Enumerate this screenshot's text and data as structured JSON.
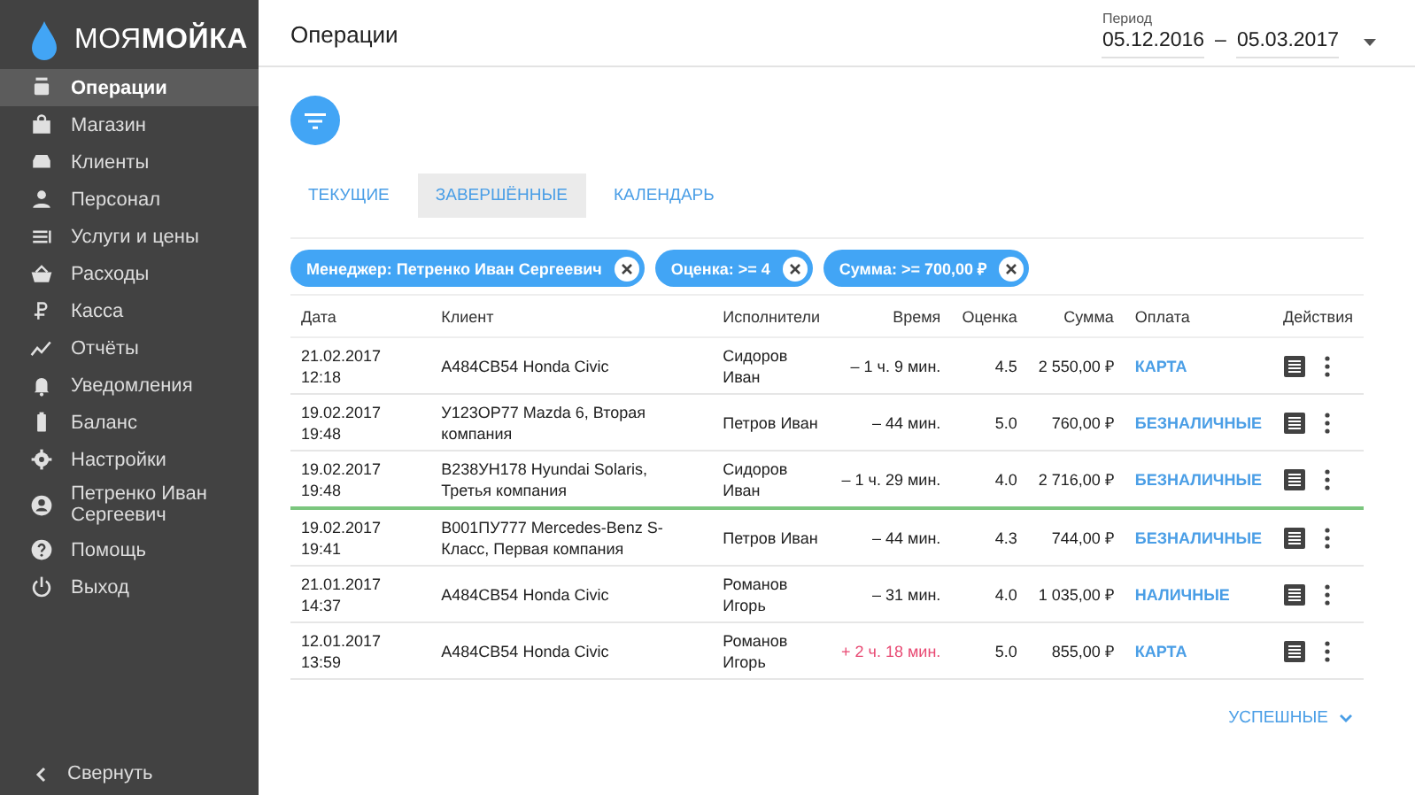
{
  "logo": {
    "light": "МОЯ",
    "bold": "МОЙКА"
  },
  "sidebar": {
    "items": [
      {
        "label": "Операции",
        "selected": true
      },
      {
        "label": "Магазин",
        "selected": false
      },
      {
        "label": "Клиенты",
        "selected": false
      },
      {
        "label": "Персонал",
        "selected": false
      },
      {
        "label": "Услуги и цены",
        "selected": false
      },
      {
        "label": "Расходы",
        "selected": false
      },
      {
        "label": "Касса",
        "selected": false
      },
      {
        "label": "Отчёты",
        "selected": false
      },
      {
        "label": "Уведомления",
        "selected": false
      },
      {
        "label": "Баланс",
        "selected": false
      },
      {
        "label": "Настройки",
        "selected": false
      },
      {
        "label": "Петренко Иван Сергеевич",
        "selected": false
      },
      {
        "label": "Помощь",
        "selected": false
      },
      {
        "label": "Выход",
        "selected": false
      }
    ],
    "collapse": "Свернуть"
  },
  "header": {
    "title": "Операции",
    "period_label": "Период",
    "date_from": "05.12.2016",
    "separator": "–",
    "date_to": "05.03.2017"
  },
  "tabs": [
    {
      "label": "ТЕКУЩИЕ",
      "selected": false
    },
    {
      "label": "ЗАВЕРШЁННЫЕ",
      "selected": true
    },
    {
      "label": "КАЛЕНДАРЬ",
      "selected": false
    }
  ],
  "filters": [
    "Менеджер: Петренко Иван Сергеевич",
    "Оценка: >= 4",
    "Сумма: >= 700,00 ₽"
  ],
  "table": {
    "columns": [
      "Дата",
      "Клиент",
      "Исполнители",
      "Время",
      "Оценка",
      "Сумма",
      "Оплата",
      "Действия"
    ],
    "rows": [
      {
        "date": "21.02.2017 12:18",
        "client": "А484СВ54 Honda Civic",
        "performers": "Сидоров Иван",
        "time": "– 1 ч. 9 мин.",
        "overdue": false,
        "rating": "4.5",
        "sum": "2 550,00 ₽",
        "payment": "КАРТА",
        "marked": false
      },
      {
        "date": "19.02.2017 19:48",
        "client": "У123ОР77 Mazda 6, Вторая компания",
        "performers": "Петров Иван",
        "time": "– 44 мин.",
        "overdue": false,
        "rating": "5.0",
        "sum": "760,00 ₽",
        "payment": "БЕЗНАЛИЧНЫЕ",
        "marked": false
      },
      {
        "date": "19.02.2017 19:48",
        "client": "В238УН178 Hyundai Solaris, Третья компания",
        "performers": "Сидоров Иван",
        "time": "– 1 ч. 29 мин.",
        "overdue": false,
        "rating": "4.0",
        "sum": "2 716,00 ₽",
        "payment": "БЕЗНАЛИЧНЫЕ",
        "marked": true
      },
      {
        "date": "19.02.2017 19:41",
        "client": "В001ПУ777 Mercedes-Benz S-Класс, Первая компания",
        "performers": "Петров Иван",
        "time": "– 44 мин.",
        "overdue": false,
        "rating": "4.3",
        "sum": "744,00 ₽",
        "payment": "БЕЗНАЛИЧНЫЕ",
        "marked": false
      },
      {
        "date": "21.01.2017 14:37",
        "client": "А484СВ54 Honda Civic",
        "performers": "Романов Игорь",
        "time": "– 31 мин.",
        "overdue": false,
        "rating": "4.0",
        "sum": "1 035,00 ₽",
        "payment": "НАЛИЧНЫЕ",
        "marked": false
      },
      {
        "date": "12.01.2017 13:59",
        "client": "А484СВ54 Honda Civic",
        "performers": "Романов Игорь",
        "time": "+ 2 ч. 18 мин.",
        "overdue": true,
        "rating": "5.0",
        "sum": "855,00 ₽",
        "payment": "КАРТА",
        "marked": false
      }
    ]
  },
  "more": "УСПЕШНЫЕ"
}
